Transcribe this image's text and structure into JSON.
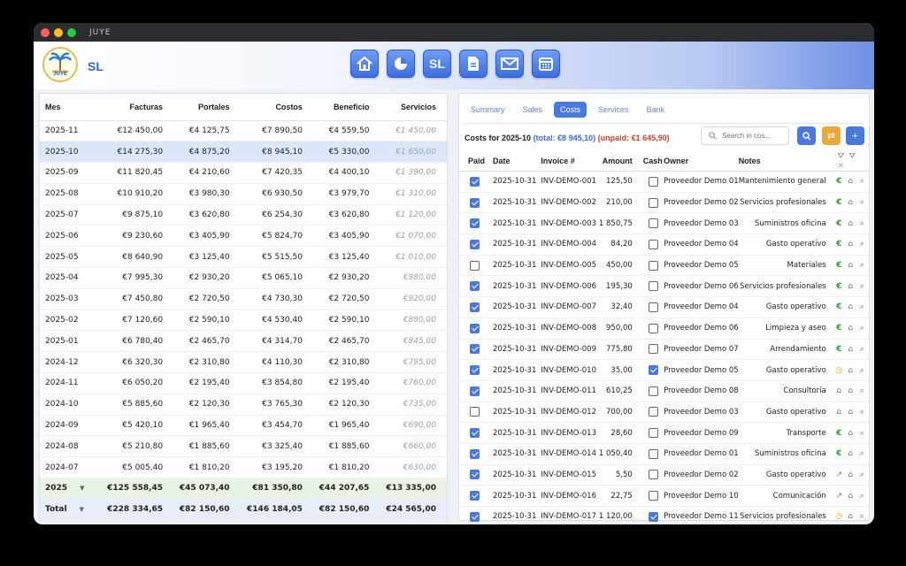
{
  "app": {
    "title": "JUYE",
    "company": "SL",
    "logo_text": "JUYE"
  },
  "nav": {
    "sl_label": "SL"
  },
  "colors": {
    "accent": "#4a78db",
    "unpaid": "#d0402e",
    "sync": "#e8a93a"
  },
  "left": {
    "headers": [
      "Mes",
      "Facturas",
      "Portales",
      "Costos",
      "Beneficio",
      "Servicios"
    ],
    "rows": [
      [
        "2025-11",
        "€12 450,00",
        "€4 125,75",
        "€7 890,50",
        "€4 559,50",
        "€1 450,00"
      ],
      [
        "2025-10",
        "€14 275,30",
        "€4 875,20",
        "€8 945,10",
        "€5 330,00",
        "€1 650,00"
      ],
      [
        "2025-09",
        "€11 820,45",
        "€4 210,60",
        "€7 420,35",
        "€4 400,10",
        "€1 390,00"
      ],
      [
        "2025-08",
        "€10 910,20",
        "€3 980,30",
        "€6 930,50",
        "€3 979,70",
        "€1 310,00"
      ],
      [
        "2025-07",
        "€9 875,10",
        "€3 620,80",
        "€6 254,30",
        "€3 620,80",
        "€1 120,00"
      ],
      [
        "2025-06",
        "€9 230,60",
        "€3 405,90",
        "€5 824,70",
        "€3 405,90",
        "€1 070,00"
      ],
      [
        "2025-05",
        "€8 640,90",
        "€3 125,40",
        "€5 515,50",
        "€3 125,40",
        "€1 010,00"
      ],
      [
        "2025-04",
        "€7 995,30",
        "€2 930,20",
        "€5 065,10",
        "€2 930,20",
        "€980,00"
      ],
      [
        "2025-03",
        "€7 450,80",
        "€2 720,50",
        "€4 730,30",
        "€2 720,50",
        "€920,00"
      ],
      [
        "2025-02",
        "€7 120,60",
        "€2 590,10",
        "€4 530,40",
        "€2 590,10",
        "€880,00"
      ],
      [
        "2025-01",
        "€6 780,40",
        "€2 465,70",
        "€4 314,70",
        "€2 465,70",
        "€845,00"
      ],
      [
        "2024-12",
        "€6 320,30",
        "€2 310,80",
        "€4 110,30",
        "€2 310,80",
        "€795,00"
      ],
      [
        "2024-11",
        "€6 050,20",
        "€2 195,40",
        "€3 854,80",
        "€2 195,40",
        "€760,00"
      ],
      [
        "2024-10",
        "€5 885,60",
        "€2 120,30",
        "€3 765,30",
        "€2 120,30",
        "€735,00"
      ],
      [
        "2024-09",
        "€5 420,10",
        "€1 965,40",
        "€3 454,70",
        "€1 965,40",
        "€690,00"
      ],
      [
        "2024-08",
        "€5 210,80",
        "€1 885,60",
        "€3 325,40",
        "€1 885,60",
        "€660,00"
      ],
      [
        "2024-07",
        "€5 005,40",
        "€1 810,20",
        "€3 195,20",
        "€1 810,20",
        "€630,00"
      ]
    ],
    "year_row": [
      "2025",
      "€125 558,45",
      "€45 073,40",
      "€81 350,80",
      "€44 207,65",
      "€13 335,00"
    ],
    "total_row": [
      "Total",
      "€228 334,65",
      "€82 150,60",
      "€146 184,05",
      "€82 150,60",
      "€24 565,00"
    ]
  },
  "right": {
    "tabs": [
      "Summary",
      "Sales",
      "Costs",
      "Services",
      "Bank"
    ],
    "active_tab": "Costs",
    "title": "Costs for 2025-10",
    "total": "(total: €8 945,10)",
    "unpaid": "(unpaid: €1 645,90)",
    "search_placeholder": "Search in cos...",
    "headers": [
      "Paid",
      "Date",
      "Invoice #",
      "Amount",
      "Cash",
      "Owner",
      "Notes"
    ],
    "rows": [
      {
        "paid": true,
        "date": "2025-10-31",
        "inv": "INV-DEMO-001",
        "amount": "125,50",
        "cash": false,
        "owner": "Proveedor Demo 01",
        "notes": "Mantenimiento general",
        "icon": "euro-icon"
      },
      {
        "paid": true,
        "date": "2025-10-31",
        "inv": "INV-DEMO-002",
        "amount": "210,00",
        "cash": false,
        "owner": "Proveedor Demo 02",
        "notes": "Servicios profesionales",
        "icon": "euro-icon"
      },
      {
        "paid": true,
        "date": "2025-10-31",
        "inv": "INV-DEMO-003",
        "amount": "1 850,75",
        "cash": false,
        "owner": "Proveedor Demo 03",
        "notes": "Suministros oficina",
        "icon": "euro-icon"
      },
      {
        "paid": true,
        "date": "2025-10-31",
        "inv": "INV-DEMO-004",
        "amount": "84,20",
        "cash": false,
        "owner": "Proveedor Demo 04",
        "notes": "Gasto operativo",
        "icon": "euro-icon"
      },
      {
        "paid": false,
        "date": "2025-10-31",
        "inv": "INV-DEMO-005",
        "amount": "450,00",
        "cash": false,
        "owner": "Proveedor Demo 05",
        "notes": "Materiales",
        "icon": "euro-icon"
      },
      {
        "paid": true,
        "date": "2025-10-31",
        "inv": "INV-DEMO-006",
        "amount": "195,30",
        "cash": false,
        "owner": "Proveedor Demo 06",
        "notes": "Servicios profesionales",
        "icon": "euro-icon"
      },
      {
        "paid": true,
        "date": "2025-10-31",
        "inv": "INV-DEMO-007",
        "amount": "32,40",
        "cash": false,
        "owner": "Proveedor Demo 04",
        "notes": "Gasto operativo",
        "icon": "euro-icon"
      },
      {
        "paid": true,
        "date": "2025-10-31",
        "inv": "INV-DEMO-008",
        "amount": "950,00",
        "cash": false,
        "owner": "Proveedor Demo 06",
        "notes": "Limpieza y aseo",
        "icon": "euro-icon"
      },
      {
        "paid": true,
        "date": "2025-10-31",
        "inv": "INV-DEMO-009",
        "amount": "775,80",
        "cash": false,
        "owner": "Proveedor Demo 07",
        "notes": "Arrendamiento",
        "icon": "euro-icon"
      },
      {
        "paid": true,
        "date": "2025-10-31",
        "inv": "INV-DEMO-010",
        "amount": "35,00",
        "cash": true,
        "owner": "Proveedor Demo 05",
        "notes": "Gasto operativo",
        "icon": "clock-icon"
      },
      {
        "paid": true,
        "date": "2025-10-31",
        "inv": "INV-DEMO-011",
        "amount": "610,25",
        "cash": false,
        "owner": "Proveedor Demo 08",
        "notes": "Consultoría",
        "icon": "bank-icon"
      },
      {
        "paid": false,
        "date": "2025-10-31",
        "inv": "INV-DEMO-012",
        "amount": "700,00",
        "cash": false,
        "owner": "Proveedor Demo 03",
        "notes": "Gasto operativo",
        "icon": "bank-icon"
      },
      {
        "paid": true,
        "date": "2025-10-31",
        "inv": "INV-DEMO-013",
        "amount": "28,60",
        "cash": false,
        "owner": "Proveedor Demo 09",
        "notes": "Transporte",
        "icon": "euro-icon"
      },
      {
        "paid": true,
        "date": "2025-10-31",
        "inv": "INV-DEMO-014",
        "amount": "1 050,40",
        "cash": false,
        "owner": "Proveedor Demo 01",
        "notes": "Suministros oficina",
        "icon": "euro-icon"
      },
      {
        "paid": true,
        "date": "2025-10-31",
        "inv": "INV-DEMO-015",
        "amount": "5,50",
        "cash": false,
        "owner": "Proveedor Demo 02",
        "notes": "Gasto operativo",
        "icon": "trend-icon"
      },
      {
        "paid": true,
        "date": "2025-10-31",
        "inv": "INV-DEMO-016",
        "amount": "22,75",
        "cash": false,
        "owner": "Proveedor Demo 10",
        "notes": "Comunicación",
        "icon": "trend-icon"
      },
      {
        "paid": true,
        "date": "2025-10-31",
        "inv": "INV-DEMO-017",
        "amount": "1 120,00",
        "cash": true,
        "owner": "Proveedor Demo 11",
        "notes": "Servicios profesionales",
        "icon": "clock-icon"
      }
    ]
  }
}
